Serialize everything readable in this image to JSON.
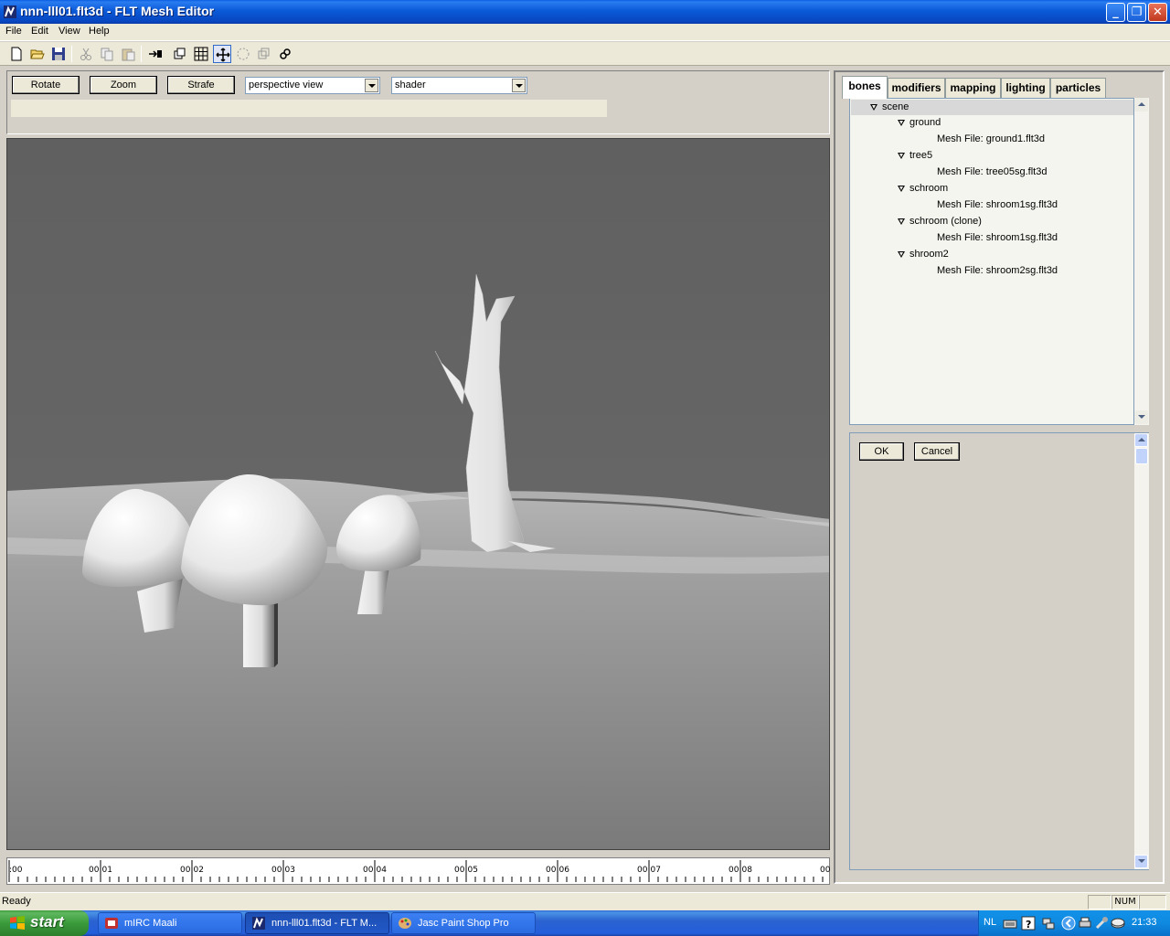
{
  "window": {
    "title": "nnn-lll01.flt3d - FLT Mesh Editor"
  },
  "menu": [
    "File",
    "Edit",
    "View",
    "Help"
  ],
  "toolbar": {
    "icons": [
      "new-file-icon",
      "open-folder-icon",
      "save-icon",
      "cut-icon",
      "copy-icon",
      "paste-icon",
      "insert-icon",
      "frames-icon",
      "grid-icon",
      "move-icon",
      "select-icon",
      "clone-icon",
      "link-icon"
    ]
  },
  "controls": {
    "rotate_label": "Rotate",
    "zoom_label": "Zoom",
    "strafe_label": "Strafe",
    "view_mode": "perspective view",
    "render_mode": "shader"
  },
  "timeline": {
    "labels": [
      ":00",
      "00:01",
      "00:02",
      "00:03",
      "00:04",
      "00:05",
      "00:06",
      "00:07",
      "00:08",
      "00"
    ]
  },
  "tabs": [
    {
      "label": "bones",
      "selected": true
    },
    {
      "label": "modifiers",
      "selected": false
    },
    {
      "label": "mapping",
      "selected": false
    },
    {
      "label": "lighting",
      "selected": false
    },
    {
      "label": "particles",
      "selected": false
    }
  ],
  "tree": {
    "rows": [
      {
        "text": "scene",
        "level": 0,
        "expander": true
      },
      {
        "text": "ground",
        "level": 1,
        "expander": true
      },
      {
        "text": "Mesh File: ground1.flt3d",
        "level": 2,
        "expander": false
      },
      {
        "text": "tree5",
        "level": 1,
        "expander": true
      },
      {
        "text": "Mesh File: tree05sg.flt3d",
        "level": 2,
        "expander": false
      },
      {
        "text": "schroom",
        "level": 1,
        "expander": true
      },
      {
        "text": "Mesh File: shroom1sg.flt3d",
        "level": 2,
        "expander": false
      },
      {
        "text": "schroom (clone)",
        "level": 1,
        "expander": true
      },
      {
        "text": "Mesh File: shroom1sg.flt3d",
        "level": 2,
        "expander": false
      },
      {
        "text": "shroom2",
        "level": 1,
        "expander": true
      },
      {
        "text": "Mesh File: shroom2sg.flt3d",
        "level": 2,
        "expander": false
      }
    ]
  },
  "props": {
    "ok_label": "OK",
    "cancel_label": "Cancel"
  },
  "status": {
    "text": "Ready",
    "num": "NUM"
  },
  "taskbar": {
    "start_label": "start",
    "tasks": [
      {
        "label": "mIRC Maali",
        "active": false
      },
      {
        "label": "nnn-lll01.flt3d - FLT M...",
        "active": true
      },
      {
        "label": "Jasc Paint Shop Pro",
        "active": false
      }
    ],
    "lang": "NL",
    "clock": "21:33"
  }
}
